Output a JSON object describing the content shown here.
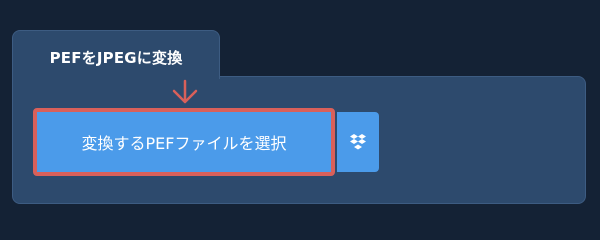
{
  "converter": {
    "tab_title": "PEFをJPEGに変換",
    "select_button_label": "変換するPEFファイルを選択"
  },
  "icons": {
    "arrow": "arrow-down-icon",
    "dropbox": "dropbox-icon"
  },
  "colors": {
    "page_background": "#142235",
    "panel_background": "#2d4a6d",
    "button_background": "#4b9bea",
    "highlight_border": "#d9605a"
  }
}
